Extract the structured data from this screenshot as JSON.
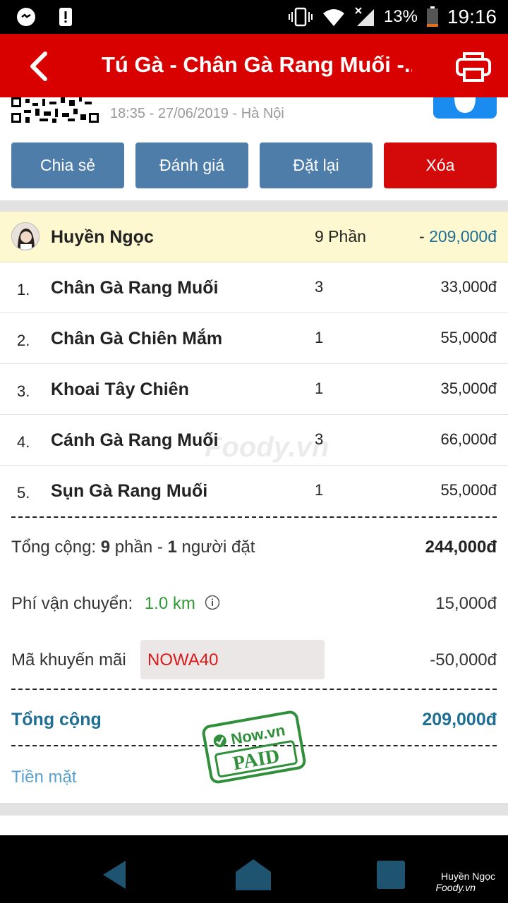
{
  "status_bar": {
    "battery_pct": "13%",
    "time": "19:16"
  },
  "app_bar": {
    "title": "Tú Gà - Chân Gà Rang Muối -...",
    "back_icon": "chevron-left-icon",
    "print_icon": "printer-icon"
  },
  "order": {
    "meta": "18:35 - 27/06/2019 - Hà Nội"
  },
  "actions": {
    "share": "Chia sẻ",
    "rate": "Đánh giá",
    "reorder": "Đặt lại",
    "delete": "Xóa"
  },
  "user": {
    "name": "Huyền Ngọc",
    "qty": "9 Phần",
    "total_sign": "- ",
    "total": "209,000đ"
  },
  "items": [
    {
      "idx": "1.",
      "name": "Chân Gà Rang Muối",
      "qty": "3",
      "price": "33,000đ"
    },
    {
      "idx": "2.",
      "name": "Chân Gà Chiên Mắm",
      "qty": "1",
      "price": "55,000đ"
    },
    {
      "idx": "3.",
      "name": "Khoai Tây Chiên",
      "qty": "1",
      "price": "35,000đ"
    },
    {
      "idx": "4.",
      "name": "Cánh Gà Rang Muối",
      "qty": "3",
      "price": "66,000đ"
    },
    {
      "idx": "5.",
      "name": "Sụn Gà Rang Muối",
      "qty": "1",
      "price": "55,000đ"
    }
  ],
  "summary": {
    "subtotal_prefix": "Tổng cộng: ",
    "subtotal_parts": "9",
    "subtotal_mid": " phần - ",
    "subtotal_people": "1",
    "subtotal_suffix": " người đặt",
    "subtotal_value": "244,000đ",
    "shipping_label": "Phí vận chuyển:",
    "shipping_distance": "1.0 km",
    "shipping_value": "15,000đ",
    "promo_label": "Mã khuyến mãi",
    "promo_code": "NOWA40",
    "promo_value": "-50,000đ",
    "grand_label": "Tổng cộng",
    "grand_value": "209,000đ",
    "payment_method": "Tiền mặt"
  },
  "stamp": {
    "brand": "Now.vn",
    "text": "PAID"
  },
  "watermark": "Foody.vn",
  "nav": {
    "user": "Huyền Ngọc",
    "brand": "Foody.vn"
  },
  "colors": {
    "accent_red": "#d90000",
    "button_blue": "#4f7daa",
    "total_teal": "#1f6f95",
    "green": "#2e9a34"
  }
}
